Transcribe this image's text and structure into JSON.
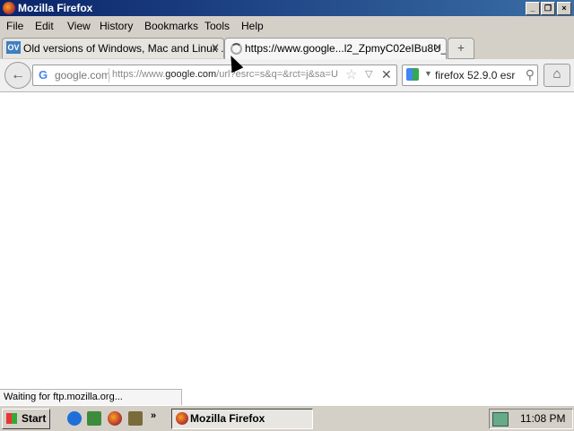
{
  "window": {
    "title": "Mozilla Firefox"
  },
  "menu": [
    "File",
    "Edit",
    "View",
    "History",
    "Bookmarks",
    "Tools",
    "Help"
  ],
  "tabs": [
    {
      "label": "Old versions of Windows, Mac and Linux ...",
      "icon_text": "OV"
    },
    {
      "label": "https://www.google...l2_ZpmyC02eIBu8U_"
    }
  ],
  "navbar": {
    "site": "google.com",
    "url_prefix": "https://www.",
    "url_domain": "google.com",
    "url_rest": "/url?esrc=s&q=&rct=j&sa=U",
    "search_query": "firefox 52.9.0 esr"
  },
  "status": {
    "text": "Waiting for ftp.mozilla.org..."
  },
  "taskbar": {
    "start_label": "Start",
    "task_label": "Mozilla Firefox",
    "clock": "11:08 PM"
  },
  "colors": {
    "titlebar": "#0a246a",
    "taskbar": "#d4d0c8"
  }
}
